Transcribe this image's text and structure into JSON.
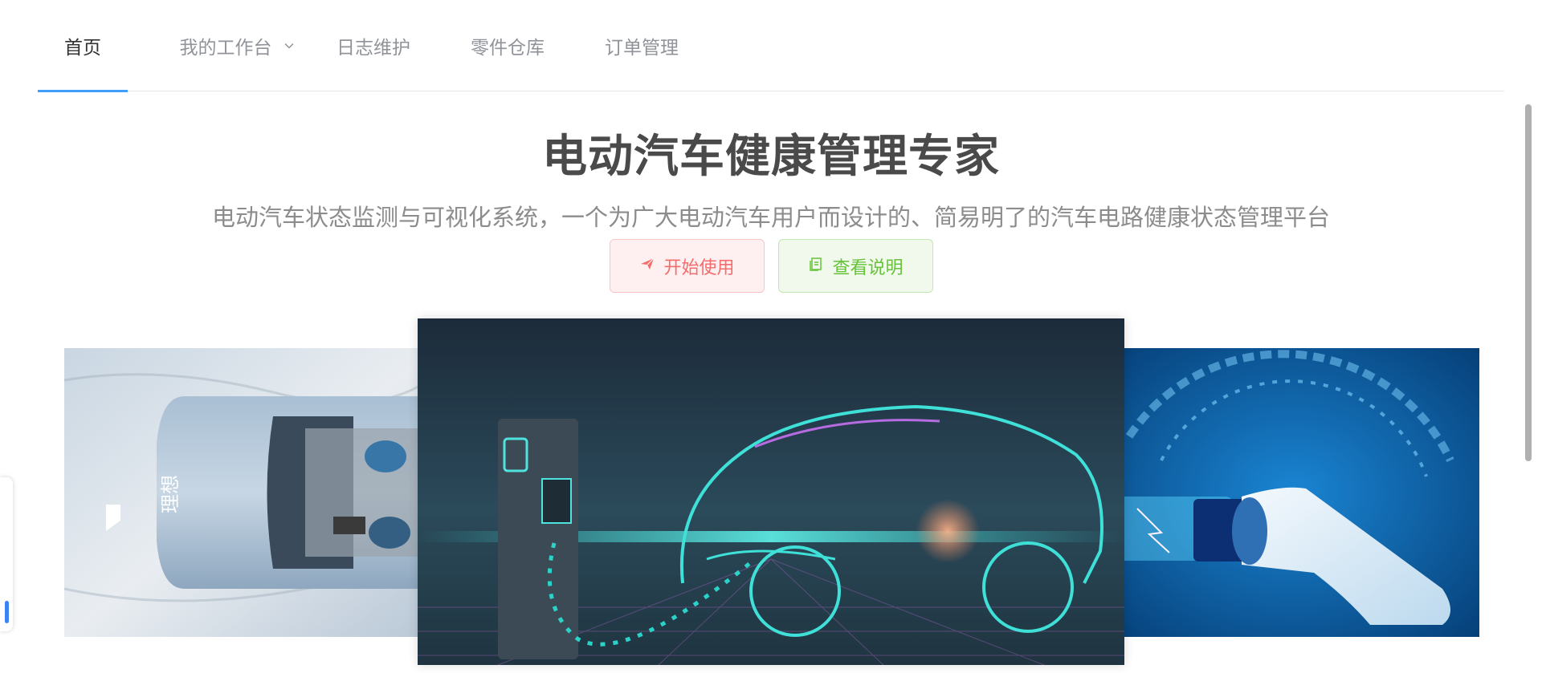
{
  "nav": {
    "items": [
      {
        "label": "首页",
        "active": true
      },
      {
        "label": "我的工作台",
        "has_dropdown": true
      },
      {
        "label": "日志维护"
      },
      {
        "label": "零件仓库"
      },
      {
        "label": "订单管理"
      }
    ],
    "accent_color": "#409eff"
  },
  "hero": {
    "title": "电动汽车健康管理专家",
    "subtitle": "电动汽车状态监测与可视化系统，一个为广大电动汽车用户而设计的、简易明了的汽车电路健康状态管理平台",
    "buttons": {
      "start_label": "开始使用",
      "start_icon": "paper-plane-icon",
      "doc_label": "查看说明",
      "doc_icon": "document-copy-icon"
    }
  },
  "carousel": {
    "slides": [
      {
        "name": "lixiang-car-topview",
        "logo_text": "理想"
      },
      {
        "name": "ev-charging-station-car-outline"
      },
      {
        "name": "charging-plug-closeup"
      }
    ],
    "active_index": 1
  },
  "colors": {
    "title": "#4a4a4a",
    "subtitle": "#8c8c8c",
    "danger": "#f56c6c",
    "success": "#67c23a"
  }
}
